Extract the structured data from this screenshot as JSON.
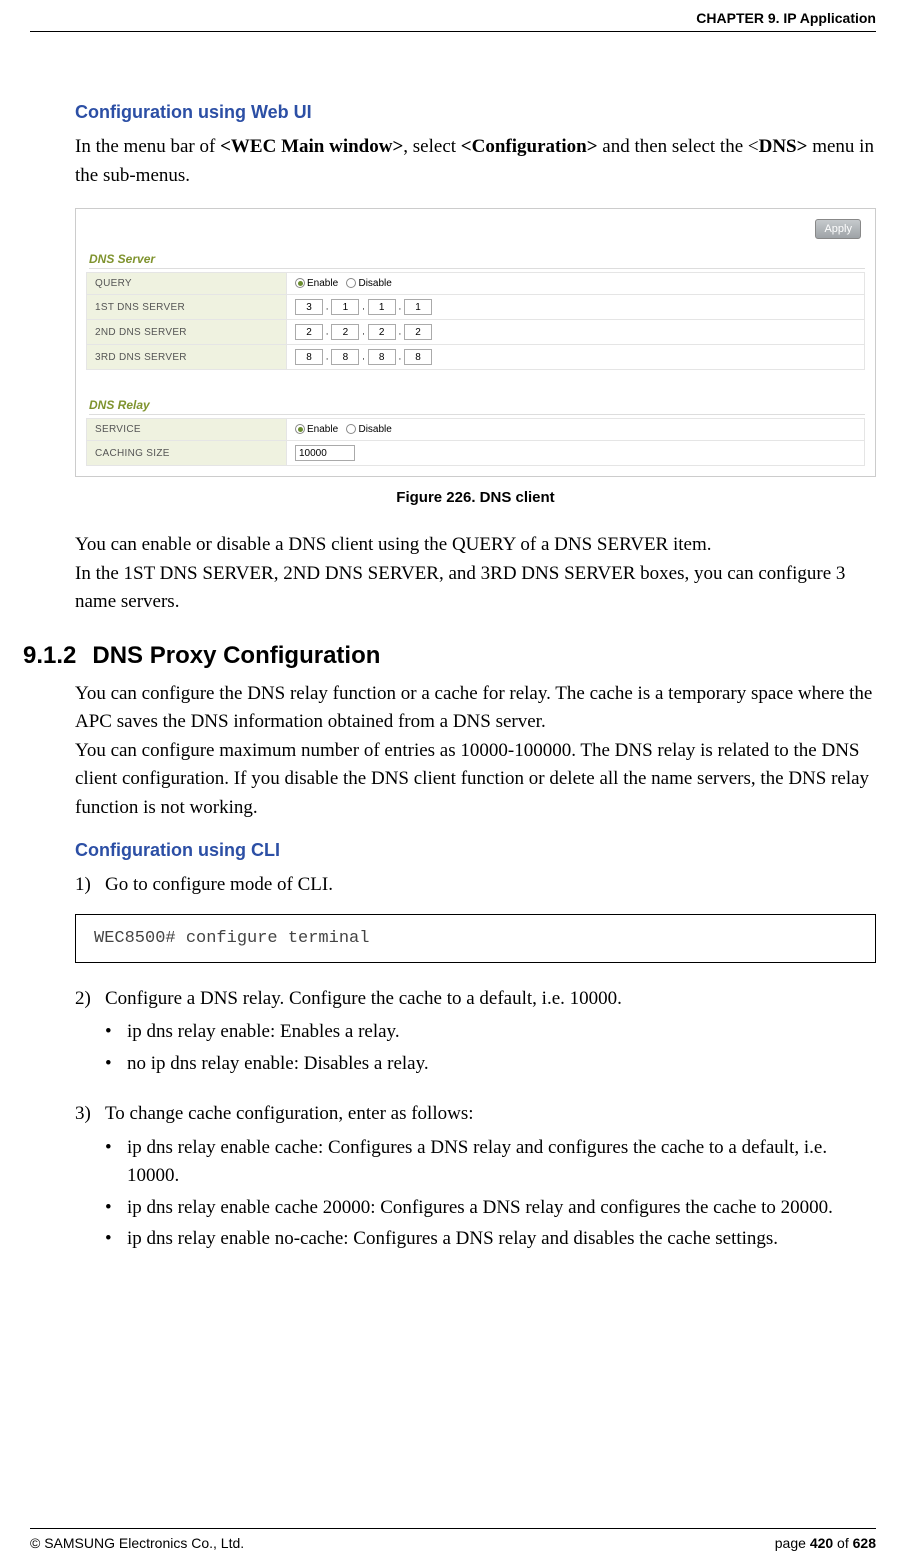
{
  "header": {
    "chapter": "CHAPTER 9. IP Application"
  },
  "s1": {
    "title": "Configuration using Web UI",
    "intro_1": "In the menu bar of ",
    "intro_b1": "<WEC Main window>",
    "intro_2": ", select ",
    "intro_b2": "<Configuration>",
    "intro_3": " and then select the <",
    "intro_b3": "DNS>",
    "intro_4": " menu in the sub-menus."
  },
  "screenshot": {
    "apply": "Apply",
    "dns_server_label": "DNS Server",
    "dns_relay_label": "DNS Relay",
    "rows": {
      "query": "QUERY",
      "first": "1ST DNS SERVER",
      "second": "2ND DNS SERVER",
      "third": "3RD DNS SERVER",
      "service": "SERVICE",
      "caching": "CACHING SIZE"
    },
    "enable": "Enable",
    "disable": "Disable",
    "ip1": [
      "3",
      "1",
      "1",
      "1"
    ],
    "ip2": [
      "2",
      "2",
      "2",
      "2"
    ],
    "ip3": [
      "8",
      "8",
      "8",
      "8"
    ],
    "caching_value": "10000"
  },
  "figure_caption": "Figure 226. DNS client",
  "para1": "You can enable or disable a DNS client using the QUERY of a DNS SERVER item.",
  "para2": "In the 1ST DNS SERVER, 2ND DNS SERVER, and 3RD DNS SERVER boxes, you can configure 3 name servers.",
  "s2": {
    "num": "9.1.2",
    "title": "DNS Proxy Configuration",
    "para1": "You can configure the DNS relay function or a cache for relay. The cache is a temporary space where the APC saves the DNS information obtained from a DNS server.",
    "para2": "You can configure maximum number of entries as 10000-100000. The DNS relay is related to the DNS client configuration. If you disable the DNS client function or delete all the name servers, the DNS relay function is not working."
  },
  "s3": {
    "title": "Configuration using CLI",
    "step1": "Go to configure mode of CLI.",
    "code": "WEC8500# configure terminal",
    "step2": "Configure a DNS relay. Configure the cache to a default, i.e. 10000.",
    "step2_b1": "ip dns relay enable: Enables a relay.",
    "step2_b2": "no ip dns relay enable: Disables a relay.",
    "step3": "To change cache configuration, enter as follows:",
    "step3_b1": "ip dns relay enable cache: Configures a DNS relay and configures the cache to a default, i.e. 10000.",
    "step3_b2": "ip dns relay enable cache 20000: Configures a DNS relay and configures the cache to 20000.",
    "step3_b3": "ip dns relay enable no-cache: Configures a DNS relay and disables the cache settings."
  },
  "footer": {
    "copyright": "© SAMSUNG Electronics Co., Ltd.",
    "page_prefix": "page ",
    "page_current": "420",
    "page_mid": " of ",
    "page_total": "628"
  },
  "chart_data": {
    "type": "table",
    "title": "DNS client configuration form",
    "sections": [
      {
        "name": "DNS Server",
        "fields": [
          {
            "label": "QUERY",
            "type": "radio",
            "options": [
              "Enable",
              "Disable"
            ],
            "selected": "Enable"
          },
          {
            "label": "1ST DNS SERVER",
            "type": "ip",
            "value": [
              3,
              1,
              1,
              1
            ]
          },
          {
            "label": "2ND DNS SERVER",
            "type": "ip",
            "value": [
              2,
              2,
              2,
              2
            ]
          },
          {
            "label": "3RD DNS SERVER",
            "type": "ip",
            "value": [
              8,
              8,
              8,
              8
            ]
          }
        ]
      },
      {
        "name": "DNS Relay",
        "fields": [
          {
            "label": "SERVICE",
            "type": "radio",
            "options": [
              "Enable",
              "Disable"
            ],
            "selected": "Enable"
          },
          {
            "label": "CACHING SIZE",
            "type": "number",
            "value": 10000
          }
        ]
      }
    ]
  }
}
